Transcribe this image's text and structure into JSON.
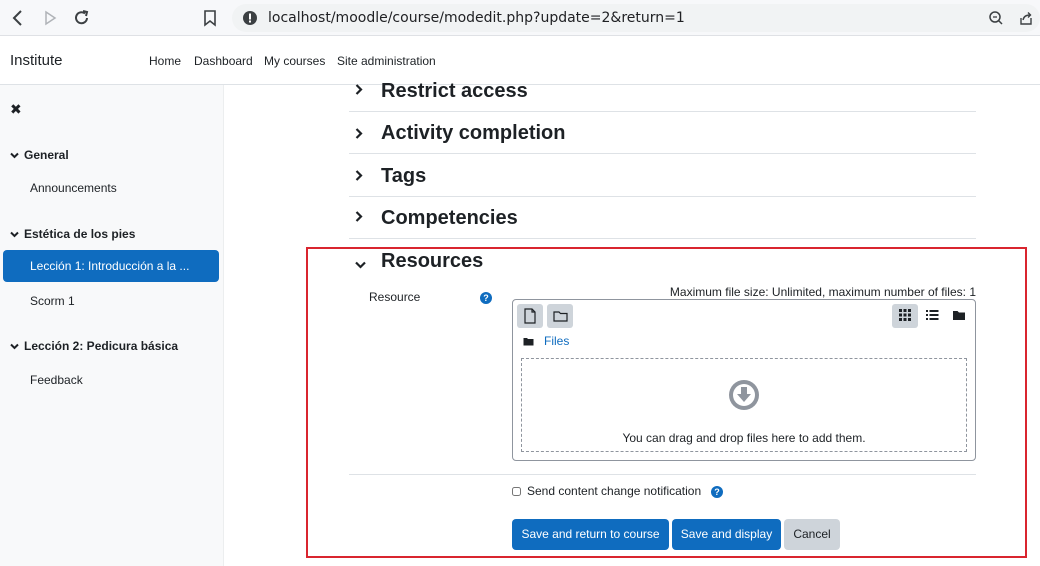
{
  "browser": {
    "url": "localhost/moodle/course/modedit.php?update=2&return=1"
  },
  "navbar": {
    "brand": "Institute",
    "links": [
      "Home",
      "Dashboard",
      "My courses",
      "Site administration"
    ]
  },
  "drawer": {
    "close_icon": "✖",
    "sections": [
      {
        "title": "General",
        "items": [
          "Announcements"
        ]
      },
      {
        "title": "Estética de los pies",
        "items": [
          "Lección 1: Introducción a la ...",
          "Scorm 1"
        ]
      },
      {
        "title": "Lección 2: Pedicura básica",
        "items": [
          "Feedback"
        ]
      }
    ]
  },
  "form": {
    "sections": [
      "Restrict access",
      "Activity completion",
      "Tags",
      "Competencies",
      "Resources"
    ],
    "resource_label": "Resource",
    "max_note": "Maximum file size: Unlimited, maximum number of files: 1",
    "path_label": "Files",
    "drop_text": "You can drag and drop files here to add them.",
    "notify_label": "Send content change notification",
    "buttons": {
      "save_return": "Save and return to course",
      "save_display": "Save and display",
      "cancel": "Cancel"
    }
  },
  "colors": {
    "primary": "#0f6cbf",
    "highlight": "#d9252f",
    "secondary": "#ced4da"
  }
}
